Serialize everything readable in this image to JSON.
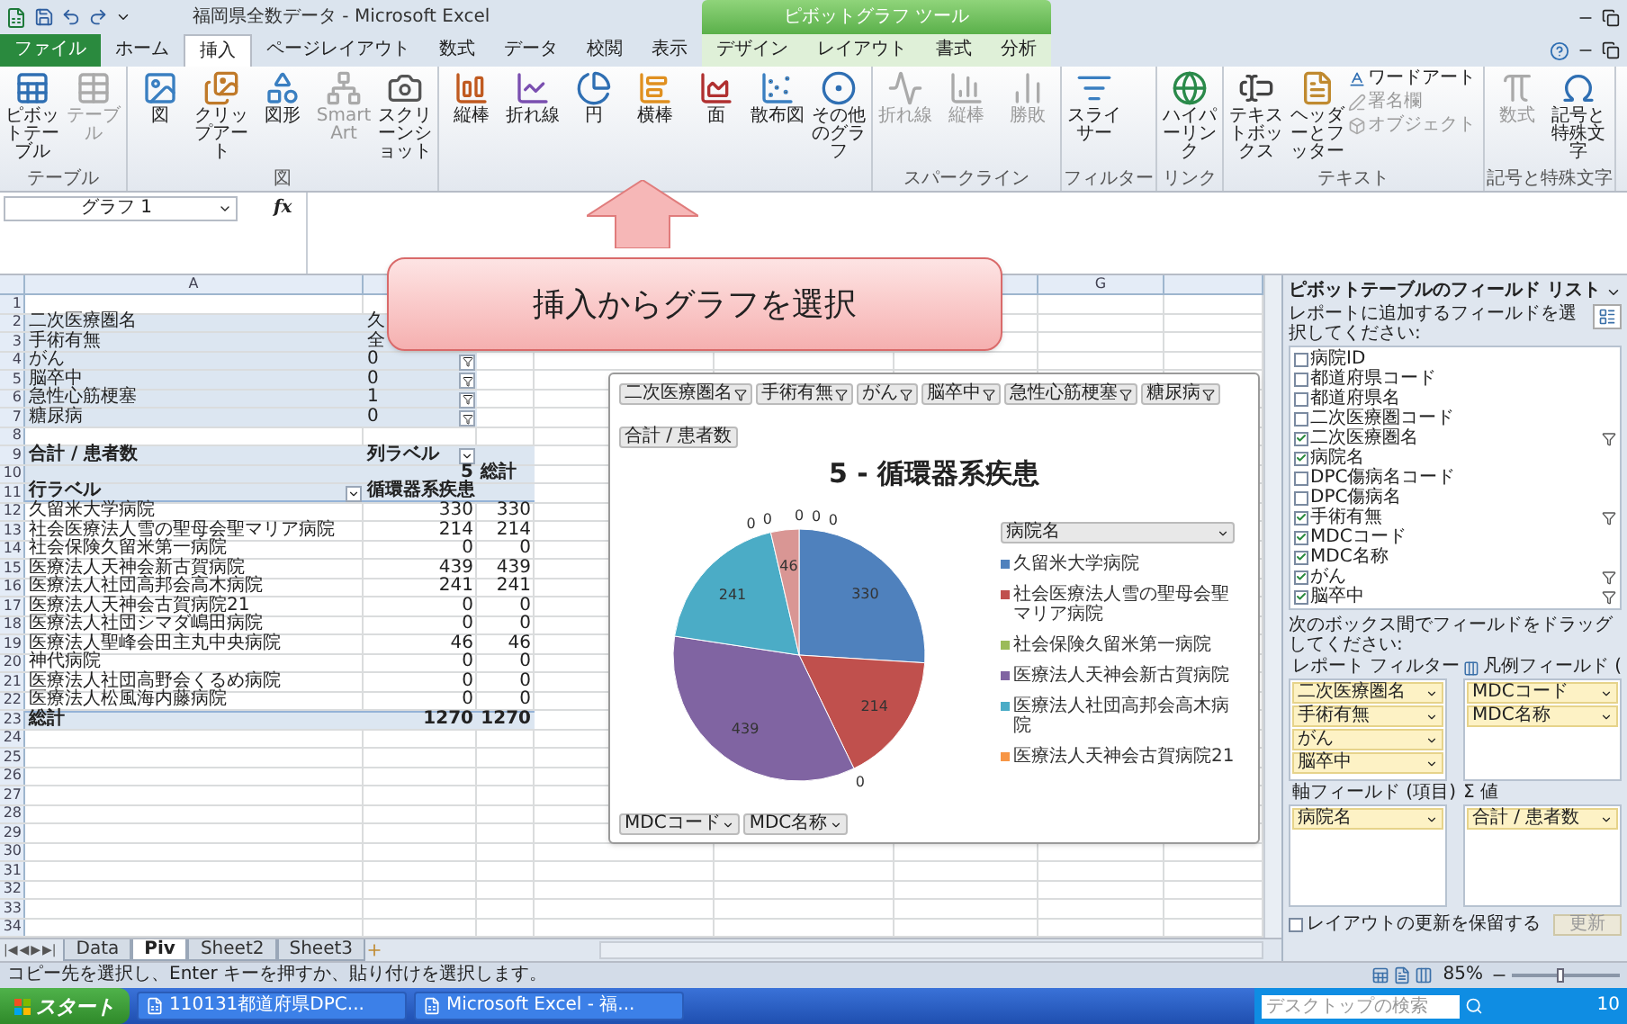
{
  "title_bar": {
    "title": "福岡県全数データ - Microsoft Excel",
    "context_header": "ピボットグラフ ツール"
  },
  "tabs": [
    {
      "label": "ファイル",
      "kind": "file",
      "selected": false
    },
    {
      "label": "ホーム",
      "kind": "main",
      "selected": false
    },
    {
      "label": "挿入",
      "kind": "main",
      "selected": true
    },
    {
      "label": "ページレイアウト",
      "kind": "main",
      "selected": false
    },
    {
      "label": "数式",
      "kind": "main",
      "selected": false
    },
    {
      "label": "データ",
      "kind": "main",
      "selected": false
    },
    {
      "label": "校閲",
      "kind": "main",
      "selected": false
    },
    {
      "label": "表示",
      "kind": "main",
      "selected": false
    },
    {
      "label": "デザイン",
      "kind": "context",
      "selected": false
    },
    {
      "label": "レイアウト",
      "kind": "context",
      "selected": false
    },
    {
      "label": "書式",
      "kind": "context",
      "selected": false
    },
    {
      "label": "分析",
      "kind": "context",
      "selected": false
    }
  ],
  "ribbon": [
    {
      "label": "テーブル",
      "buttons": [
        {
          "label": "ピボットテーブル",
          "kind": "large",
          "disabled": false
        },
        {
          "label": "テーブル",
          "kind": "large",
          "disabled": true
        }
      ]
    },
    {
      "label": "図",
      "buttons": [
        {
          "label": "図",
          "kind": "large",
          "disabled": false
        },
        {
          "label": "クリップアート",
          "kind": "large",
          "disabled": false
        },
        {
          "label": "図形",
          "kind": "large",
          "disabled": false
        },
        {
          "label": "SmartArt",
          "kind": "large",
          "disabled": true
        },
        {
          "label": "スクリーンショット",
          "kind": "large",
          "disabled": false
        }
      ]
    },
    {
      "buttons": [
        {
          "label": "縦棒",
          "kind": "large",
          "disabled": false
        },
        {
          "label": "折れ線",
          "kind": "large",
          "disabled": false
        },
        {
          "label": "円",
          "kind": "large",
          "disabled": false
        },
        {
          "label": "横棒",
          "kind": "large",
          "disabled": false
        },
        {
          "label": "面",
          "kind": "large",
          "disabled": false
        },
        {
          "label": "散布図",
          "kind": "large",
          "disabled": false
        },
        {
          "label": "その他のグラフ",
          "kind": "large",
          "disabled": false
        }
      ]
    },
    {
      "label": "スパークライン",
      "buttons": [
        {
          "label": "折れ線",
          "kind": "large",
          "disabled": true
        },
        {
          "label": "縦棒",
          "kind": "large",
          "disabled": true
        },
        {
          "label": "勝敗",
          "kind": "large",
          "disabled": true
        }
      ]
    },
    {
      "label": "フィルター",
      "buttons": [
        {
          "label": "スライサー",
          "kind": "large",
          "disabled": false
        }
      ]
    },
    {
      "label": "リンク",
      "buttons": [
        {
          "label": "ハイパーリンク",
          "kind": "large",
          "disabled": false
        }
      ]
    },
    {
      "label": "テキスト",
      "buttons": [
        {
          "label": "テキストボックス",
          "kind": "large",
          "disabled": false
        },
        {
          "label": "ヘッダーとフッター",
          "kind": "large",
          "disabled": false
        },
        {
          "label": "ワードアート",
          "kind": "small",
          "disabled": false
        },
        {
          "label": "署名欄",
          "kind": "small",
          "disabled": true
        },
        {
          "label": "オブジェクト",
          "kind": "small",
          "disabled": true
        }
      ]
    },
    {
      "label": "記号と特殊文字",
      "buttons": [
        {
          "label": "数式",
          "kind": "large",
          "disabled": true
        },
        {
          "label": "記号と特殊文字",
          "kind": "large",
          "disabled": false
        }
      ]
    }
  ],
  "formula_bar": {
    "name_box": "グラフ 1",
    "function_label": "fx"
  },
  "callout": {
    "text": "挿入からグラフを選択"
  },
  "sheet": {
    "columns": [
      "A",
      null,
      null,
      null,
      null,
      null,
      "G",
      null
    ],
    "rows": [
      {
        "num": "1",
        "kind": "blank"
      },
      {
        "num": "2",
        "kind": "filter",
        "cells": [
          "二次医療圏名",
          "久"
        ]
      },
      {
        "num": "3",
        "kind": "filter",
        "cells": [
          "手術有無",
          "全"
        ]
      },
      {
        "num": "4",
        "kind": "filter",
        "cells": [
          "がん",
          "0"
        ],
        "filter_button": true
      },
      {
        "num": "5",
        "kind": "filter",
        "cells": [
          "脳卒中",
          "0"
        ],
        "filter_button": true
      },
      {
        "num": "6",
        "kind": "filter",
        "cells": [
          "急性心筋梗塞",
          "1"
        ],
        "filter_button": true
      },
      {
        "num": "7",
        "kind": "filter",
        "cells": [
          "糖尿病",
          "0"
        ],
        "filter_button": true
      },
      {
        "num": "8",
        "kind": "blank"
      },
      {
        "num": "9",
        "kind": "col_header",
        "cells": [
          "合計 / 患者数",
          "列ラベル"
        ]
      },
      {
        "num": "10",
        "kind": "sub_header",
        "cells": [
          "",
          "5",
          "総計"
        ]
      },
      {
        "num": "11",
        "kind": "row_header",
        "cells": [
          "行ラベル",
          "循環器系疾患"
        ]
      },
      {
        "num": "12",
        "kind": "data",
        "cells": [
          "久留米大学病院",
          "330",
          "330"
        ]
      },
      {
        "num": "13",
        "kind": "data",
        "cells": [
          "社会医療法人雪の聖母会聖マリア病院",
          "214",
          "214"
        ]
      },
      {
        "num": "14",
        "kind": "data",
        "cells": [
          "社会保険久留米第一病院",
          "0",
          "0"
        ]
      },
      {
        "num": "15",
        "kind": "data",
        "cells": [
          "医療法人天神会新古賀病院",
          "439",
          "439"
        ]
      },
      {
        "num": "16",
        "kind": "data",
        "cells": [
          "医療法人社団高邦会高木病院",
          "241",
          "241"
        ]
      },
      {
        "num": "17",
        "kind": "data",
        "cells": [
          "医療法人天神会古賀病院21",
          "0",
          "0"
        ]
      },
      {
        "num": "18",
        "kind": "data",
        "cells": [
          "医療法人社団シマダ嶋田病院",
          "0",
          "0"
        ]
      },
      {
        "num": "19",
        "kind": "data",
        "cells": [
          "医療法人聖峰会田主丸中央病院",
          "46",
          "46"
        ]
      },
      {
        "num": "20",
        "kind": "data",
        "cells": [
          "神代病院",
          "0",
          "0"
        ]
      },
      {
        "num": "21",
        "kind": "data",
        "cells": [
          "医療法人社団高野会くるめ病院",
          "0",
          "0"
        ]
      },
      {
        "num": "22",
        "kind": "data",
        "cells": [
          "医療法人松風海内藤病院",
          "0",
          "0"
        ]
      },
      {
        "num": "23",
        "kind": "total",
        "cells": [
          "総計",
          "1270",
          "1270"
        ]
      },
      {
        "num": "24",
        "kind": "blank"
      },
      {
        "num": "25",
        "kind": "blank"
      },
      {
        "num": "26",
        "kind": "blank"
      },
      {
        "num": "27",
        "kind": "blank"
      },
      {
        "num": "28",
        "kind": "blank"
      },
      {
        "num": "29",
        "kind": "blank"
      },
      {
        "num": "30",
        "kind": "blank"
      },
      {
        "num": "31",
        "kind": "blank"
      },
      {
        "num": "32",
        "kind": "blank"
      },
      {
        "num": "33",
        "kind": "blank"
      },
      {
        "num": "34",
        "kind": "blank"
      }
    ]
  },
  "chart": {
    "filter_buttons": [
      "二次医療圏名",
      "手術有無",
      "がん",
      "脳卒中",
      "急性心筋梗塞",
      "糖尿病"
    ],
    "value_button": "合計 / 患者数",
    "legend_header": "病院名",
    "legend": [
      {
        "label": "久留米大学病院",
        "color": "#4f81bd"
      },
      {
        "label": "社会医療法人雪の聖母会聖マリア病院",
        "color": "#c0504d"
      },
      {
        "label": "社会保険久留米第一病院",
        "color": "#9bbb59"
      },
      {
        "label": "医療法人天神会新古賀病院",
        "color": "#8064a2"
      },
      {
        "label": "医療法人社団高邦会高木病院",
        "color": "#4bacc6"
      },
      {
        "label": "医療法人天神会古賀病院21",
        "color": "#f79646"
      }
    ],
    "axis_buttons": [
      "MDCコード",
      "MDC名称"
    ],
    "chart_data": {
      "type": "pie",
      "title": "5 - 循環器系疾患",
      "data_labels": true,
      "value_labels": [
        "330",
        "214",
        "0",
        "439",
        "241",
        "0",
        "0",
        "46",
        "0",
        "0",
        "0"
      ],
      "series": [
        {
          "colors": [
            "#4f81bd",
            "#c0504d",
            null,
            "#8064a2",
            "#4bacc6",
            null,
            null,
            "#d99694",
            null,
            null,
            null
          ],
          "values": [
            330,
            214,
            0,
            439,
            241,
            0,
            0,
            46,
            0,
            0,
            0
          ]
        }
      ]
    }
  },
  "sheet_nav": [
    "|◀",
    "◀",
    "▶",
    "▶|"
  ],
  "sheet_tabs": [
    {
      "label": "Data",
      "selected": false
    },
    {
      "label": "Piv",
      "selected": true
    },
    {
      "label": "Sheet2",
      "selected": false
    },
    {
      "label": "Sheet3",
      "selected": false
    }
  ],
  "field_list": {
    "title": "ピボットテーブルのフィールド リスト",
    "instruction": "レポートに追加するフィールドを選択してください:",
    "fields": [
      {
        "label": "病院ID",
        "checked": false,
        "filtered": false
      },
      {
        "label": "都道府県コード",
        "checked": false,
        "filtered": false
      },
      {
        "label": "都道府県名",
        "checked": false,
        "filtered": false
      },
      {
        "label": "二次医療圏コード",
        "checked": false,
        "filtered": false
      },
      {
        "label": "二次医療圏名",
        "checked": true,
        "filtered": true
      },
      {
        "label": "病院名",
        "checked": true,
        "filtered": false
      },
      {
        "label": "DPC傷病名コード",
        "checked": false,
        "filtered": false
      },
      {
        "label": "DPC傷病名",
        "checked": false,
        "filtered": false
      },
      {
        "label": "手術有無",
        "checked": true,
        "filtered": true
      },
      {
        "label": "MDCコード",
        "checked": true,
        "filtered": false
      },
      {
        "label": "MDC名称",
        "checked": true,
        "filtered": false
      },
      {
        "label": "がん",
        "checked": true,
        "filtered": true
      },
      {
        "label": "脳卒中",
        "checked": true,
        "filtered": true
      }
    ],
    "drag_hint": "次のボックス間でフィールドをドラッグしてください:",
    "areas": [
      {
        "label": "レポート フィルター",
        "kind": "filter",
        "items": [
          "二次医療圏名",
          "手術有無",
          "がん",
          "脳卒中"
        ]
      },
      {
        "label": "凡例フィールド (",
        "kind": "legend",
        "items": [
          "MDCコード",
          "MDC名称"
        ]
      },
      {
        "label": "軸フィールド (項目)",
        "kind": "axis",
        "items": [
          "病院名"
        ]
      },
      {
        "label": "Σ 値",
        "kind": "values",
        "items": [
          "合計 / 患者数"
        ]
      }
    ],
    "defer": {
      "label": "レイアウトの更新を保留する",
      "checked": false
    },
    "update_button": {
      "label": "更新",
      "disabled": true
    }
  },
  "status_bar": {
    "message": "コピー先を選択し、Enter キーを押すか、貼り付けを選択します。",
    "zoom": "85%",
    "level": 0.45
  },
  "taskbar": {
    "start": "スタート",
    "tasks": [
      "110131都道府県DPC...",
      "Microsoft Excel - 福..."
    ],
    "search_placeholder": "デスクトップの検索",
    "clock": "10"
  }
}
